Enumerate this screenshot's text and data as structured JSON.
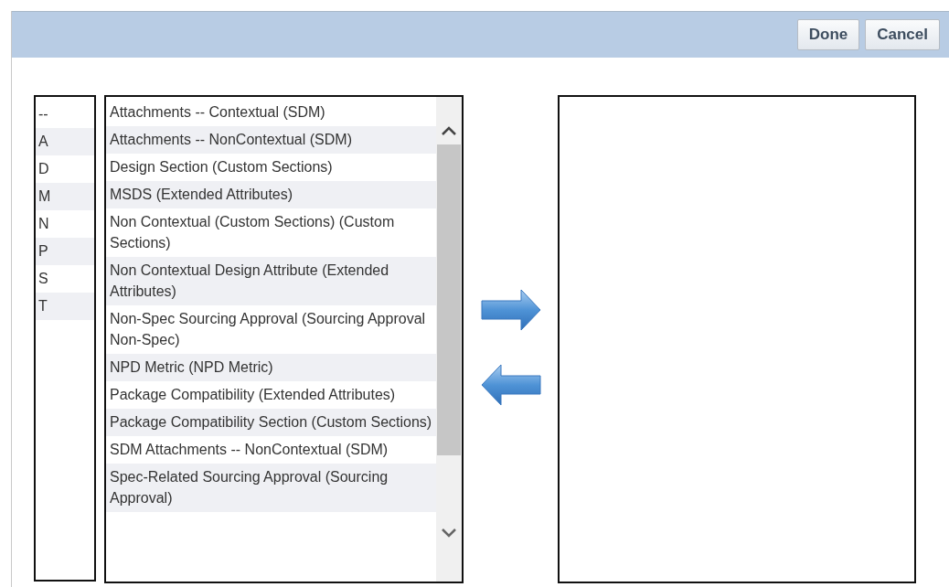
{
  "toolbar": {
    "buttons": [
      "Done",
      "Cancel"
    ]
  },
  "letter_filter": [
    "--",
    "A",
    "D",
    "M",
    "N",
    "P",
    "S",
    "T"
  ],
  "available_list": [
    "Attachments -- Contextual (SDM)",
    "Attachments -- NonContextual (SDM)",
    "Design Section (Custom Sections)",
    "MSDS (Extended Attributes)",
    "Non Contextual (Custom Sections) (Custom Sections)",
    "Non Contextual Design Attribute (Extended Attributes)",
    "Non-Spec Sourcing Approval (Sourcing Approval Non-Spec)",
    "NPD Metric (NPD Metric)",
    "Package Compatibility (Extended Attributes)",
    "Package Compatibility Section (Custom Sections)",
    "SDM Attachments -- NonContextual (SDM)",
    "Spec-Related Sourcing Approval (Sourcing Approval)"
  ]
}
